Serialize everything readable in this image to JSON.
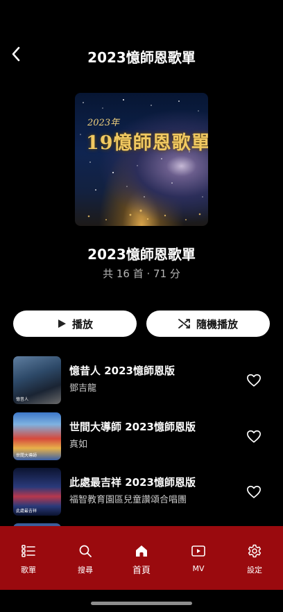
{
  "header": {
    "title": "2023憶師恩歌單",
    "back_icon": "chevron-left-icon"
  },
  "album": {
    "cover_year": "2023年",
    "cover_title": "19憶師恩歌單",
    "title": "2023憶師恩歌單",
    "meta": "共 16 首 · 71 分"
  },
  "actions": {
    "play_label": "播放",
    "shuffle_label": "隨機播放"
  },
  "songs": [
    {
      "title": "憶昔人 2023憶師恩版",
      "artist": "鄧吉龍",
      "thumb_caption": "憶昔人"
    },
    {
      "title": "世間大導師 2023憶師恩版",
      "artist": "真如",
      "thumb_caption": "世間大導師"
    },
    {
      "title": "此處最吉祥 2023憶師恩版",
      "artist": "福智教育園區兒童讚頌合唱團",
      "thumb_caption": "此處最吉祥"
    }
  ],
  "nav": {
    "items": [
      {
        "label": "歌單",
        "icon": "playlist-icon"
      },
      {
        "label": "搜尋",
        "icon": "search-icon"
      },
      {
        "label": "首頁",
        "icon": "home-icon",
        "active": true
      },
      {
        "label": "MV",
        "icon": "video-icon"
      },
      {
        "label": "設定",
        "icon": "gear-icon"
      }
    ]
  },
  "colors": {
    "nav_background": "#9a0a0e",
    "background": "#000000",
    "button_background": "#ffffff"
  }
}
